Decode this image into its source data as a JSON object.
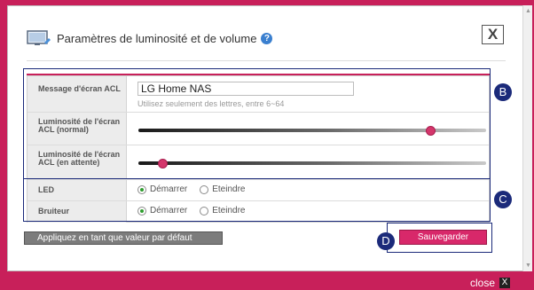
{
  "header": {
    "title": "Paramètres de luminosité et de volume",
    "help_glyph": "?",
    "close_glyph": "X"
  },
  "lcd_message": {
    "label": "Message d'écran ACL",
    "value": "LG Home NAS",
    "hint": "Utilisez seulement des lettres, entre 6~64"
  },
  "brightness_normal": {
    "label": "Luminosité de l'écran ACL (normal)",
    "level_percent": 84
  },
  "brightness_standby": {
    "label": "Luminosité de l'écran ACL (en attente)",
    "level_percent": 7
  },
  "led": {
    "label": "LED",
    "options": [
      "Démarrer",
      "Eteindre"
    ],
    "selected": "Démarrer"
  },
  "buzzer": {
    "label": "Bruiteur",
    "options": [
      "Démarrer",
      "Eteindre"
    ],
    "selected": "Démarrer"
  },
  "buttons": {
    "default_label": "Appliquez en tant que valeur par défaut",
    "save_label": "Sauvegarder"
  },
  "callouts": {
    "b": "B",
    "c": "C",
    "d": "D"
  },
  "footer": {
    "close_label": "close",
    "close_glyph": "X"
  },
  "colors": {
    "accent": "#c8205a",
    "callout": "#1b2a7a",
    "slider_knob": "#d4366b"
  },
  "icons": {
    "monitor": "monitor-icon",
    "help": "help-icon",
    "close": "close-icon"
  }
}
